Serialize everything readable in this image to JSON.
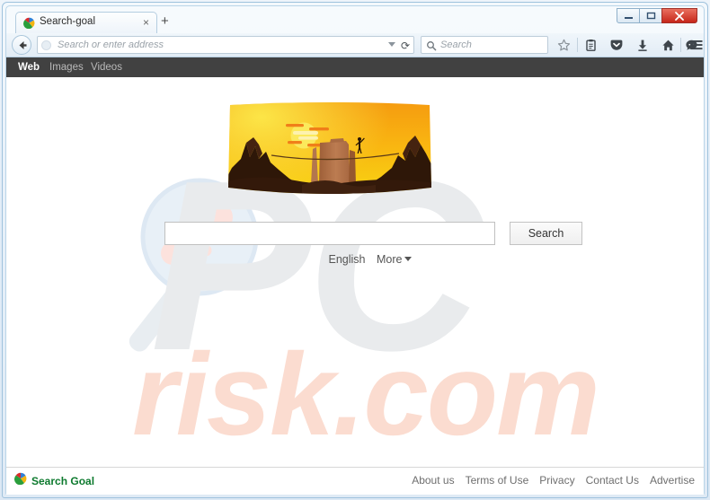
{
  "browser": {
    "tab": {
      "title": "Search-goal",
      "close_label": "×",
      "favicon": "search-goal-favicon"
    },
    "new_tab_label": "+",
    "window_controls": {
      "minimize": "—",
      "maximize": "❐",
      "close": "✕"
    },
    "toolbar": {
      "back_icon": "back-arrow-icon",
      "url_placeholder": "Search or enter address",
      "url_value": "",
      "reload_label": "⟳",
      "search_placeholder": "Search",
      "search_value": "",
      "icons": [
        {
          "name": "bookmark-star-icon",
          "glyph": "☆"
        },
        {
          "name": "reading-list-icon",
          "glyph": "Ὕ2"
        },
        {
          "name": "pocket-icon",
          "glyph": "pocket"
        },
        {
          "name": "downloads-icon",
          "glyph": "⬇"
        },
        {
          "name": "home-icon",
          "glyph": "⌂"
        },
        {
          "name": "firefox-hello-icon",
          "glyph": "●"
        },
        {
          "name": "menu-hamburger-icon",
          "glyph": "☰"
        }
      ]
    }
  },
  "page": {
    "site_nav": [
      {
        "label": "Web",
        "active": true
      },
      {
        "label": "Images",
        "active": false
      },
      {
        "label": "Videos",
        "active": false
      }
    ],
    "banner": {
      "name": "desert-sunset-tightrope-banner",
      "description": "Desert canyon sunset with a tightrope walker",
      "sky_top_color": "#f5a21b",
      "sky_bottom_color": "#f7d51a",
      "sun_color": "#f6e55c",
      "mesa_color": "#b8764a",
      "rock_color": "#3a1f0e"
    },
    "search": {
      "input_value": "",
      "input_placeholder": "",
      "button_label": "Search"
    },
    "language": {
      "current": "English",
      "more_label": "More",
      "caret": "▼"
    },
    "footer": {
      "logo_text": "Search Goal",
      "logo_color": "#0d7a2e",
      "links": [
        "About us",
        "Terms of Use",
        "Privacy",
        "Contact Us",
        "Advertise"
      ]
    },
    "watermark": {
      "text_primary": "PC",
      "text_secondary": "risk.com",
      "primary_color": "#e8eaec",
      "secondary_color": "#fbdcd0"
    }
  }
}
